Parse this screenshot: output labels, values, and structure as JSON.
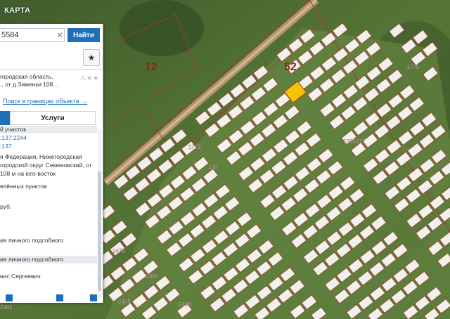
{
  "brand": "КАРТА",
  "search": {
    "value": "5584",
    "button": "Найти"
  },
  "info": {
    "address": [
      "городская область,",
      "., от д Зименки 108..."
    ],
    "link": "Поиск в границах объекта →",
    "tab": "Услуги",
    "rows": [
      {
        "text": "й участок",
        "style": "band"
      },
      {
        "text": ":137:2244",
        "style": "link"
      },
      {
        "text": ":137",
        "style": "link"
      },
      {
        "text": "я Федерация, Нижегородская",
        "style": "plain"
      },
      {
        "text": "городской округ Семеновский, от",
        "style": "plain"
      },
      {
        "text": "108 м на юго-восток",
        "style": "plain"
      },
      {
        "text": "елённых пунктов",
        "style": "plain"
      },
      {
        "text": "руб.",
        "style": "plain"
      },
      {
        "text": "ия личного подсобного",
        "style": "plain"
      },
      {
        "text": "ия личного подсобного",
        "style": "band"
      },
      {
        "text": "нис Сергеевич",
        "style": "plain"
      }
    ]
  },
  "map": {
    "labels": [
      {
        "text": "52",
        "kind": "big"
      },
      {
        "text": "12",
        "kind": "big"
      },
      {
        "text": "1770",
        "kind": "small"
      },
      {
        "text": "1772",
        "kind": "small"
      },
      {
        "text": "1000137",
        "kind": "small"
      },
      {
        "text": "2475",
        "kind": "small"
      },
      {
        "text": "2486",
        "kind": "small"
      },
      {
        "text": "2485",
        "kind": "small"
      },
      {
        "text": "2498",
        "kind": "small"
      },
      {
        "text": "2461",
        "kind": "small"
      },
      {
        "text": "136",
        "kind": "small"
      }
    ],
    "colors": {
      "parcel_border": "#a33a2c",
      "parcel_fill": "#ffffff",
      "selected": "#f5c400",
      "road": "#c49a7e"
    }
  }
}
